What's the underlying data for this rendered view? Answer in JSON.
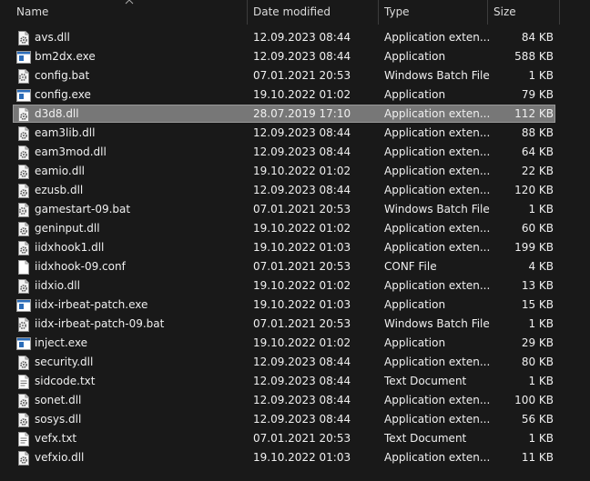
{
  "columns": {
    "name": "Name",
    "date": "Date modified",
    "type": "Type",
    "size": "Size"
  },
  "files": [
    {
      "name": "avs.dll",
      "date": "12.09.2023 08:44",
      "type": "Application exten...",
      "size": "84 KB",
      "icon": "dll-gear-icon"
    },
    {
      "name": "bm2dx.exe",
      "date": "12.09.2023 08:44",
      "type": "Application",
      "size": "588 KB",
      "icon": "exe-window-icon"
    },
    {
      "name": "config.bat",
      "date": "07.01.2021 20:53",
      "type": "Windows Batch File",
      "size": "1 KB",
      "icon": "bat-gear-icon"
    },
    {
      "name": "config.exe",
      "date": "19.10.2022 01:02",
      "type": "Application",
      "size": "79 KB",
      "icon": "exe-window-icon"
    },
    {
      "name": "d3d8.dll",
      "date": "28.07.2019 17:10",
      "type": "Application exten...",
      "size": "112 KB",
      "icon": "dll-gear-icon",
      "selected": true
    },
    {
      "name": "eam3lib.dll",
      "date": "12.09.2023 08:44",
      "type": "Application exten...",
      "size": "88 KB",
      "icon": "dll-gear-icon"
    },
    {
      "name": "eam3mod.dll",
      "date": "12.09.2023 08:44",
      "type": "Application exten...",
      "size": "64 KB",
      "icon": "dll-gear-icon"
    },
    {
      "name": "eamio.dll",
      "date": "19.10.2022 01:02",
      "type": "Application exten...",
      "size": "22 KB",
      "icon": "dll-gear-icon"
    },
    {
      "name": "ezusb.dll",
      "date": "12.09.2023 08:44",
      "type": "Application exten...",
      "size": "120 KB",
      "icon": "dll-gear-icon"
    },
    {
      "name": "gamestart-09.bat",
      "date": "07.01.2021 20:53",
      "type": "Windows Batch File",
      "size": "1 KB",
      "icon": "bat-gear-icon"
    },
    {
      "name": "geninput.dll",
      "date": "19.10.2022 01:02",
      "type": "Application exten...",
      "size": "60 KB",
      "icon": "dll-gear-icon"
    },
    {
      "name": "iidxhook1.dll",
      "date": "19.10.2022 01:03",
      "type": "Application exten...",
      "size": "199 KB",
      "icon": "dll-gear-icon"
    },
    {
      "name": "iidxhook-09.conf",
      "date": "07.01.2021 20:53",
      "type": "CONF File",
      "size": "4 KB",
      "icon": "blank-file-icon"
    },
    {
      "name": "iidxio.dll",
      "date": "19.10.2022 01:02",
      "type": "Application exten...",
      "size": "13 KB",
      "icon": "dll-gear-icon"
    },
    {
      "name": "iidx-irbeat-patch.exe",
      "date": "19.10.2022 01:03",
      "type": "Application",
      "size": "15 KB",
      "icon": "exe-window-icon"
    },
    {
      "name": "iidx-irbeat-patch-09.bat",
      "date": "07.01.2021 20:53",
      "type": "Windows Batch File",
      "size": "1 KB",
      "icon": "bat-gear-icon"
    },
    {
      "name": "inject.exe",
      "date": "19.10.2022 01:02",
      "type": "Application",
      "size": "29 KB",
      "icon": "exe-window-icon"
    },
    {
      "name": "security.dll",
      "date": "12.09.2023 08:44",
      "type": "Application exten...",
      "size": "80 KB",
      "icon": "dll-gear-icon"
    },
    {
      "name": "sidcode.txt",
      "date": "12.09.2023 08:44",
      "type": "Text Document",
      "size": "1 KB",
      "icon": "text-file-icon"
    },
    {
      "name": "sonet.dll",
      "date": "12.09.2023 08:44",
      "type": "Application exten...",
      "size": "100 KB",
      "icon": "dll-gear-icon"
    },
    {
      "name": "sosys.dll",
      "date": "12.09.2023 08:44",
      "type": "Application exten...",
      "size": "56 KB",
      "icon": "dll-gear-icon"
    },
    {
      "name": "vefx.txt",
      "date": "07.01.2021 20:53",
      "type": "Text Document",
      "size": "1 KB",
      "icon": "text-file-icon"
    },
    {
      "name": "vefxio.dll",
      "date": "19.10.2022 01:03",
      "type": "Application exten...",
      "size": "11 KB",
      "icon": "dll-gear-icon"
    }
  ],
  "colors": {
    "background": "#191919",
    "selection": "#777777",
    "text": "#f0f0f0",
    "exe_accent": "#2b6cb8"
  }
}
